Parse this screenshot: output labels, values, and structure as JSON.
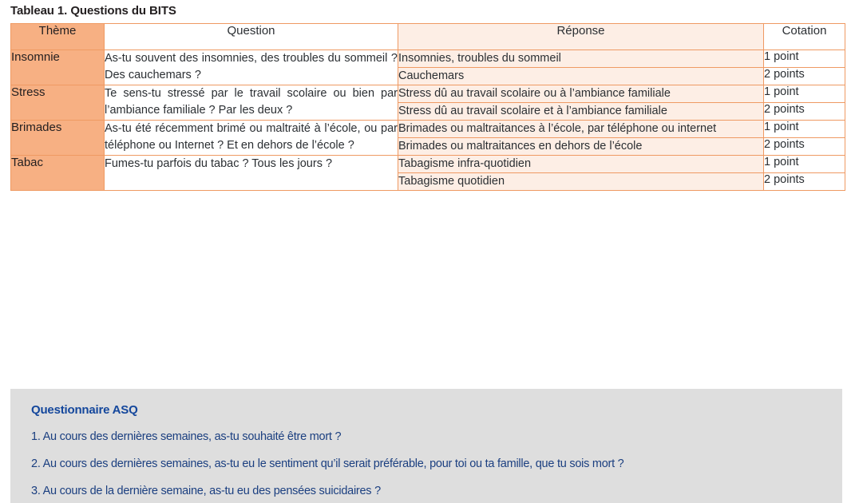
{
  "title": "Tableau 1. Questions du BITS",
  "colors": {
    "header_orange": "#f7b083",
    "theme_orange": "#f7b083",
    "reponse_peach": "#fdeee5",
    "border_orange": "#ef9a63",
    "panel_gray": "#dedede",
    "asq_blue": "#14479c",
    "asq_text_blue": "#1b3f80"
  },
  "table": {
    "headers": {
      "theme": "Thème",
      "question": "Question",
      "reponse": "Réponse",
      "cotation": "Cotation"
    },
    "rows": [
      {
        "theme": "Insomnie",
        "question": "As-tu souvent des insomnies, des troubles du sommeil ? Des cauchemars ?",
        "answers": [
          {
            "reponse": "Insomnies, troubles du sommeil",
            "cotation": "1 point"
          },
          {
            "reponse": "Cauchemars",
            "cotation": "2 points"
          }
        ]
      },
      {
        "theme": "Stress",
        "question": "Te sens-tu stressé par le travail scolaire ou bien par l’ambiance familiale ? Par les deux ?",
        "answers": [
          {
            "reponse": "Stress dû au travail scolaire ou à l’ambiance familiale",
            "cotation": "1 point"
          },
          {
            "reponse": "Stress dû au travail scolaire et à l’ambiance familiale",
            "cotation": "2 points"
          }
        ]
      },
      {
        "theme": "Brimades",
        "question": "As-tu été récemment brimé ou maltraité à l’école, ou par téléphone ou Internet ? Et en dehors de l’école ?",
        "answers": [
          {
            "reponse": "Brimades ou maltraitances à l’école, par téléphone ou internet",
            "cotation": "1 point"
          },
          {
            "reponse": "Brimades ou maltraitances en dehors de l’école",
            "cotation": "2 points"
          }
        ]
      },
      {
        "theme": "Tabac",
        "question": "Fumes-tu parfois du tabac ? Tous les jours ?",
        "answers": [
          {
            "reponse": "Tabagisme infra-quotidien",
            "cotation": "1 point"
          },
          {
            "reponse": "Tabagisme quotidien",
            "cotation": "2 points"
          }
        ]
      }
    ]
  },
  "asq": {
    "heading": "Questionnaire ASQ",
    "items": [
      "1. Au cours des dernières semaines, as-tu souhaité être mort ?",
      "2. Au cours des dernières semaines, as-tu eu le sentiment qu’il serait préférable, pour toi ou ta famille, que tu sois mort ?",
      "3. Au cours de la dernière semaine, as-tu eu des pensées suicidaires ?"
    ]
  }
}
